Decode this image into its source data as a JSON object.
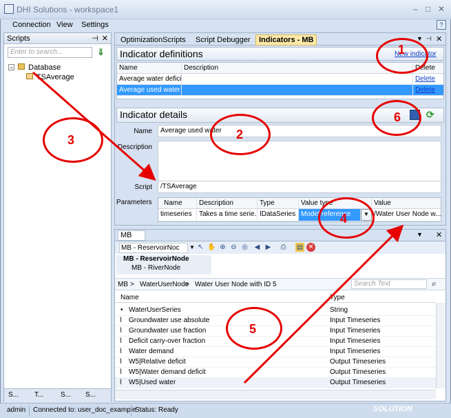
{
  "window": {
    "title": "DHI Solutions - workspace1",
    "controls": [
      "–",
      "□",
      "✕"
    ]
  },
  "menu": {
    "items": [
      "Connection",
      "View",
      "Settings"
    ],
    "help_icon": "help-icon"
  },
  "scripts_panel": {
    "title": "Scripts",
    "search_placeholder": "Enter to search...",
    "tree": {
      "root": "Database",
      "child": "TSAverage"
    },
    "bottom_tabs": [
      "S...",
      "T...",
      "S...",
      "S..."
    ]
  },
  "doc_tabs": {
    "tabs": [
      "OptimizationScripts",
      "Script Debugger",
      "Indicators - MB"
    ],
    "active": "Indicators - MB"
  },
  "indicator_definitions": {
    "title": "Indicator definitions",
    "new_link": "New indicator",
    "columns": [
      "Name",
      "Description",
      "Delete"
    ],
    "rows": [
      {
        "name": "Average water deficit",
        "description": "",
        "action": "Delete",
        "selected": false
      },
      {
        "name": "Average used water",
        "description": "",
        "action": "Delete",
        "selected": true
      }
    ]
  },
  "indicator_details": {
    "title": "Indicator details",
    "name_label": "Name",
    "name_value": "Average used water",
    "description_label": "Description",
    "description_value": "",
    "script_label": "Script",
    "script_value": "/TSAverage",
    "parameters_label": "Parameters",
    "param_columns": [
      "Name",
      "Description",
      "Type",
      "Value type",
      "Value"
    ],
    "param_row": {
      "name": "timeseries",
      "description": "Takes a time serie...",
      "type": "IDataSeries",
      "value_type": "Model reference",
      "value": "/Water User Node w..."
    }
  },
  "mb_panel": {
    "tab": "MB",
    "model_select": "MB - ReservoirNoc",
    "nodes": [
      "MB - ReservoirNode",
      "MB - RiverNode"
    ],
    "breadcrumb": [
      "MB",
      "WaterUserNode",
      "Water User Node with ID 5"
    ],
    "search_placeholder": "Search Text",
    "columns": [
      "Name",
      "Type"
    ],
    "rows": [
      {
        "name": "WaterUserSeries",
        "type": "String"
      },
      {
        "name": "Groundwater use absolute",
        "type": "Input Timeseries"
      },
      {
        "name": "Groundwater use fraction",
        "type": "Input Timeseries"
      },
      {
        "name": "Deficit carry-over fraction",
        "type": "Input Timeseries"
      },
      {
        "name": "Water demand",
        "type": "Input Timeseries"
      },
      {
        "name": "W5|Relative deficit",
        "type": "Output Timeseries"
      },
      {
        "name": "W5|Water demand deficit",
        "type": "Output Timeseries"
      },
      {
        "name": "W5|Used water",
        "type": "Output Timeseries"
      }
    ]
  },
  "status": {
    "user": "admin",
    "connection": "Connected to: user_doc_example",
    "state": "Status: Ready",
    "logo": "SOLUTION"
  },
  "annotations": [
    "1",
    "2",
    "3",
    "4",
    "5",
    "6"
  ],
  "colors": {
    "annotation": "#e60000",
    "selection": "#3399ff",
    "active_tab": "#fce9a9"
  }
}
